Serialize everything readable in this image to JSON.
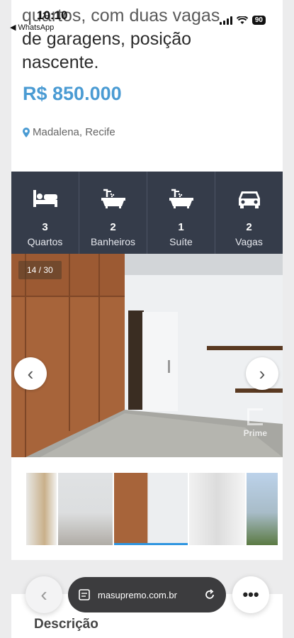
{
  "status": {
    "time": "10:10",
    "back_app": "◀ WhatsApp",
    "battery": "90"
  },
  "listing": {
    "headline_partial": "quartos, com duas vagas",
    "headline_line2": "de garagens, posição",
    "headline_line3": "nascente.",
    "price": "R$ 850.000",
    "location": "Madalena, Recife",
    "accent_color": "#4a9bd3"
  },
  "features": [
    {
      "icon": "bed-icon",
      "value": "3",
      "label": "Quartos"
    },
    {
      "icon": "bathtub-icon",
      "value": "2",
      "label": "Banheiros"
    },
    {
      "icon": "bathtub-icon",
      "value": "1",
      "label": "Suíte"
    },
    {
      "icon": "car-icon",
      "value": "2",
      "label": "Vagas"
    }
  ],
  "gallery": {
    "counter": "14 / 30",
    "watermark": "Prime",
    "thumb_count": 5,
    "active_thumb": 3
  },
  "description": {
    "heading": "Descrição"
  },
  "browser": {
    "url": "masupremo.com.br"
  }
}
